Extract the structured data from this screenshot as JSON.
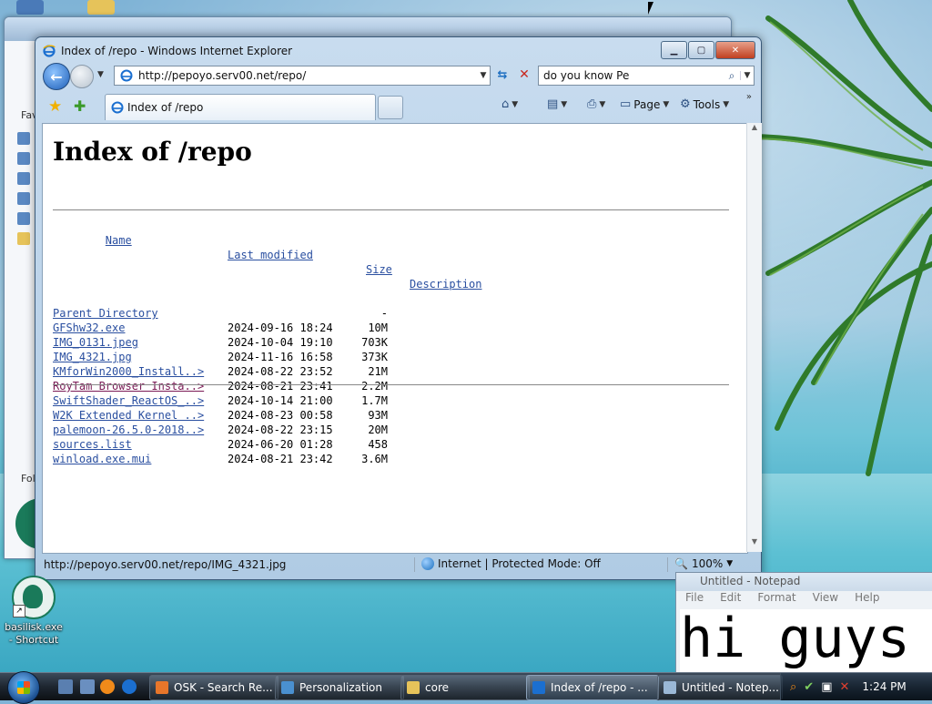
{
  "desktop": {
    "shortcut_label": "basilisk.exe - Shortcut"
  },
  "background_window": {
    "sidebar_labels": [
      "Fav",
      "Fol"
    ]
  },
  "ie": {
    "title": "Index of /repo - Windows Internet Explorer",
    "address_url": "http://pepoyo.serv00.net/repo/",
    "search_text": "do you know Pe",
    "tab_label": "Index of /repo",
    "commands": {
      "page_label": "Page",
      "tools_label": "Tools"
    },
    "status": {
      "url": "http://pepoyo.serv00.net/repo/IMG_4321.jpg",
      "zone": "Internet | Protected Mode: Off",
      "zoom": "100%"
    }
  },
  "listing": {
    "title": "Index of /repo",
    "headers": {
      "name": "Name",
      "last_modified": "Last modified",
      "size": "Size",
      "description": "Description"
    },
    "rows": [
      {
        "name": "Parent Directory",
        "date": "",
        "size": "-",
        "visited": false
      },
      {
        "name": "GFShw32.exe",
        "date": "2024-09-16 18:24",
        "size": "10M",
        "visited": false
      },
      {
        "name": "IMG_0131.jpeg",
        "date": "2024-10-04 19:10",
        "size": "703K",
        "visited": false
      },
      {
        "name": "IMG_4321.jpg",
        "date": "2024-11-16 16:58",
        "size": "373K",
        "visited": false
      },
      {
        "name": "KMforWin2000_Install..>",
        "date": "2024-08-22 23:52",
        "size": "21M",
        "visited": false
      },
      {
        "name": "RoyTam Browser Insta..>",
        "date": "2024-08-21 23:41",
        "size": "2.2M",
        "visited": true
      },
      {
        "name": "SwiftShader_ReactOS_..>",
        "date": "2024-10-14 21:00",
        "size": "1.7M",
        "visited": false
      },
      {
        "name": "W2K Extended Kernel ..>",
        "date": "2024-08-23 00:58",
        "size": "93M",
        "visited": false
      },
      {
        "name": "palemoon-26.5.0-2018..>",
        "date": "2024-08-22 23:15",
        "size": "20M",
        "visited": false
      },
      {
        "name": "sources.list",
        "date": "2024-06-20 01:28",
        "size": "458",
        "visited": false
      },
      {
        "name": "winload.exe.mui",
        "date": "2024-08-21 23:42",
        "size": "3.6M",
        "visited": false
      }
    ]
  },
  "notepad": {
    "title": "Untitled - Notepad",
    "menu": [
      "File",
      "Edit",
      "Format",
      "View",
      "Help"
    ],
    "text": "hi guys"
  },
  "taskbar": {
    "buttons": [
      {
        "label": "OSK - Search Re...",
        "icon": "firefox-icon",
        "active": false
      },
      {
        "label": "Personalization",
        "icon": "personalization-icon",
        "active": false
      },
      {
        "label": "core",
        "icon": "folder-icon",
        "active": false
      },
      {
        "label": "Index of /repo - ...",
        "icon": "ie-icon",
        "active": true
      },
      {
        "label": "Untitled - Notep...",
        "icon": "notepad-icon",
        "active": false
      }
    ],
    "clock": "1:24 PM"
  },
  "colors": {
    "link": "#2a4fa0",
    "visited_link": "#7a1a55",
    "titlebar": "#b0cbe4",
    "taskbar": "#1e2630"
  }
}
